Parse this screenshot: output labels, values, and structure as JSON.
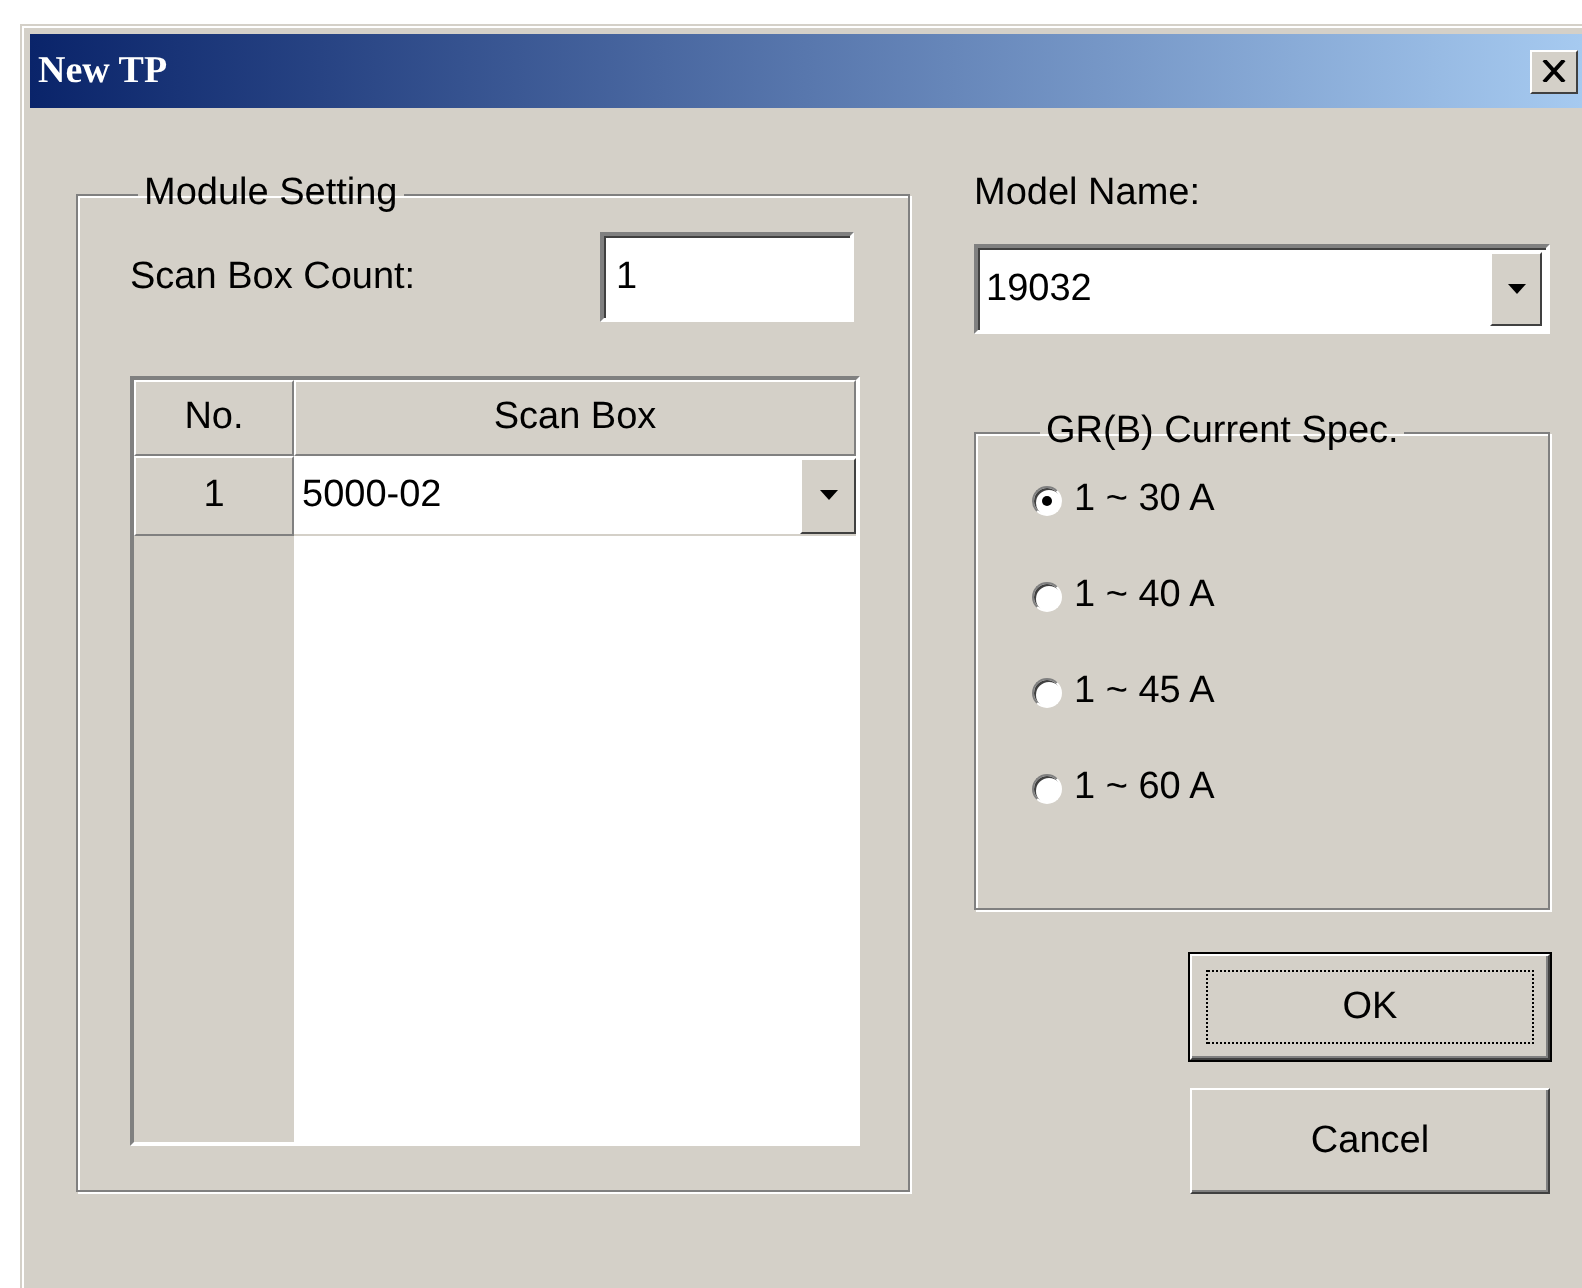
{
  "window": {
    "title": "New TP"
  },
  "module_setting": {
    "title": "Module Setting",
    "scan_box_count": {
      "label": "Scan Box Count:",
      "value": "1"
    },
    "grid": {
      "columns": [
        "No.",
        "Scan Box"
      ],
      "rows": [
        {
          "no": "1",
          "scan_box": "5000-02"
        }
      ]
    }
  },
  "model_name": {
    "label": "Model Name:",
    "value": "19032"
  },
  "current_spec": {
    "title": "GR(B) Current Spec.",
    "options": [
      {
        "label": "1 ~ 30 A",
        "selected": true
      },
      {
        "label": "1 ~ 40 A",
        "selected": false
      },
      {
        "label": "1 ~ 45 A",
        "selected": false
      },
      {
        "label": "1 ~ 60 A",
        "selected": false
      }
    ]
  },
  "buttons": [
    {
      "label": "OK",
      "default": true
    },
    {
      "label": "Cancel",
      "default": false
    }
  ]
}
